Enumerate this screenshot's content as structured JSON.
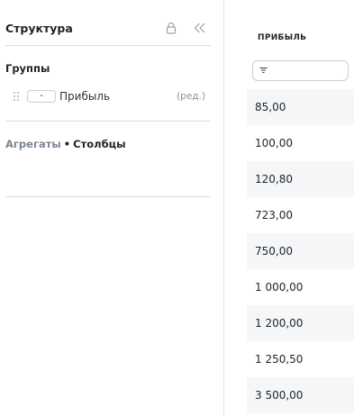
{
  "sidebar": {
    "title": "Структура",
    "groups_title": "Группы",
    "group": {
      "sort_toggle": "-",
      "label": "Прибыль",
      "edit": "(ред.)"
    },
    "aggregates_tab": "Агрегаты",
    "separator": "•",
    "columns_tab": "Столбцы"
  },
  "table": {
    "column_header": "ПРИБЫЛЬ",
    "rows": [
      "85,00",
      "100,00",
      "120,80",
      "723,00",
      "750,00",
      "1 000,00",
      "1 200,00",
      "1 250,50",
      "3 500,00"
    ]
  }
}
